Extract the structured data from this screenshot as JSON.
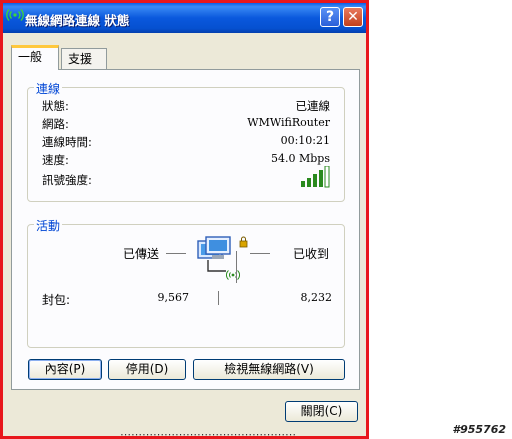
{
  "window": {
    "title": "無線網路連線 狀態",
    "help_glyph": "?",
    "close_glyph": "✕"
  },
  "tabs": [
    {
      "label": "一般",
      "active": true
    },
    {
      "label": "支援",
      "active": false
    }
  ],
  "connection": {
    "group_label": "連線",
    "rows": [
      {
        "key": "狀態:",
        "value": "已連線"
      },
      {
        "key": "網路:",
        "value": "WMWifiRouter"
      },
      {
        "key": "連線時間:",
        "value": "00:10:21"
      },
      {
        "key": "速度:",
        "value": "54.0 Mbps"
      },
      {
        "key": "訊號強度:",
        "value_icon": "signal-strength-icon",
        "signal_bars_lit": 4,
        "signal_bars_total": 5
      }
    ]
  },
  "activity": {
    "group_label": "活動",
    "sent_label": "已傳送",
    "received_label": "已收到",
    "packets_label": "封包:",
    "packets_sent": "9,567",
    "packets_received": "8,232"
  },
  "buttons": {
    "properties": "內容(P)",
    "disable": "停用(D)",
    "view_networks": "檢視無線網路(V)",
    "close": "關閉(C)"
  },
  "watermark": "#955762",
  "background_text": "⋯⋯⋯⋯⋯⋯⋯⋯⋯⋯⋯⋯⋯⋯⋯⋯",
  "colors": {
    "frame": "#e8171c",
    "titlebar": "#0a58dd",
    "group_label": "#0046d5",
    "signal": "#2a8a1e"
  }
}
